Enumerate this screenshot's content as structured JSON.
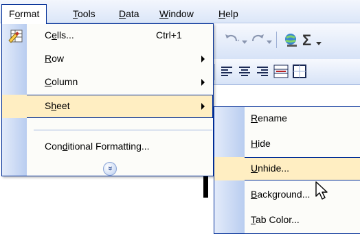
{
  "menubar": {
    "items": [
      {
        "label": "Format",
        "key": "o"
      },
      {
        "label": "Tools",
        "key": "T"
      },
      {
        "label": "Data",
        "key": "D"
      },
      {
        "label": "Window",
        "key": "W"
      },
      {
        "label": "Help",
        "key": "H"
      }
    ]
  },
  "toolbar": {
    "icons": [
      "undo-icon",
      "redo-icon",
      "hyperlink-icon",
      "autosum-icon",
      "align-left-icon",
      "align-center-icon",
      "align-right-icon",
      "merge-center-icon",
      "borders-icon"
    ],
    "autosum_glyph": "Σ"
  },
  "format_menu": {
    "items": [
      {
        "label": "Cells...",
        "shortcut": "Ctrl+1",
        "icon": "cells-icon"
      },
      {
        "label": "Row",
        "submenu": true
      },
      {
        "label": "Column",
        "submenu": true
      },
      {
        "label": "Sheet",
        "submenu": true,
        "highlighted": true
      },
      {
        "label": "Conditional Formatting..."
      }
    ],
    "expand_glyph": "»"
  },
  "sheet_menu": {
    "items": [
      {
        "label": "Rename"
      },
      {
        "label": "Hide"
      },
      {
        "label": "Unhide...",
        "highlighted": true
      },
      {
        "label": "Background..."
      },
      {
        "label": "Tab Color..."
      }
    ]
  },
  "colors": {
    "highlight": "#ffeec2",
    "menu_border": "#002d96",
    "gutter": "#b9cdf0"
  }
}
